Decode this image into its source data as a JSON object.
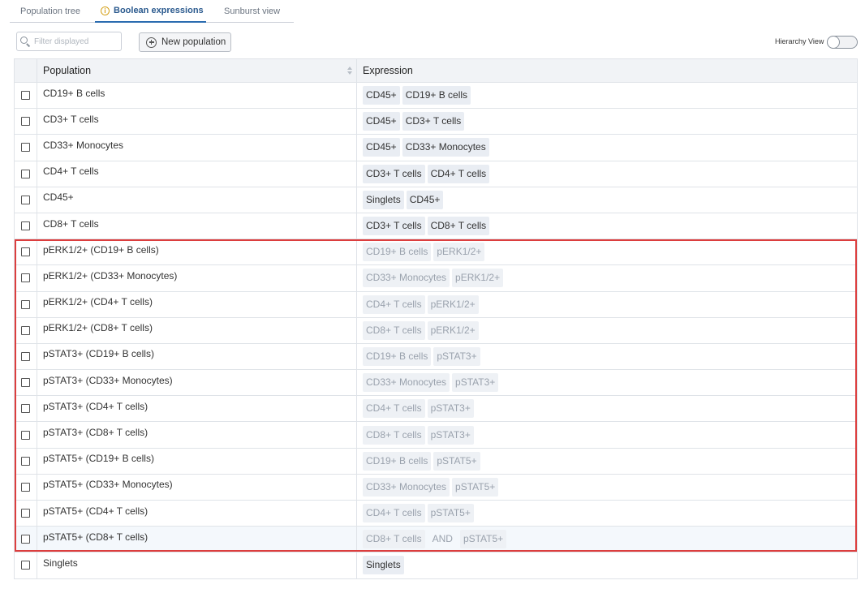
{
  "tabs": [
    {
      "label": "Population tree"
    },
    {
      "label": "Boolean expressions"
    },
    {
      "label": "Sunburst view"
    }
  ],
  "toolbar": {
    "filter_placeholder": "Filter displayed",
    "new_population_label": "New population",
    "hierarchy_view_label": "Hierarchy View",
    "hierarchy_view_on": false
  },
  "table": {
    "headers": {
      "population": "Population",
      "expression": "Expression"
    },
    "rows": [
      {
        "population": "CD19+ B cells",
        "expr": [
          "CD45+",
          "CD19+ B cells"
        ]
      },
      {
        "population": "CD3+ T cells",
        "expr": [
          "CD45+",
          "CD3+ T cells"
        ]
      },
      {
        "population": "CD33+ Monocytes",
        "expr": [
          "CD45+",
          "CD33+ Monocytes"
        ]
      },
      {
        "population": "CD4+ T cells",
        "expr": [
          "CD3+ T cells",
          "CD4+ T cells"
        ]
      },
      {
        "population": "CD45+",
        "expr": [
          "Singlets",
          "CD45+"
        ]
      },
      {
        "population": "CD8+ T cells",
        "expr": [
          "CD3+ T cells",
          "CD8+ T cells"
        ]
      },
      {
        "population": "pERK1/2+ (CD19+ B cells)",
        "expr": [
          "CD19+ B cells",
          "pERK1/2+"
        ]
      },
      {
        "population": "pERK1/2+ (CD33+ Monocytes)",
        "expr": [
          "CD33+ Monocytes",
          "pERK1/2+"
        ]
      },
      {
        "population": "pERK1/2+ (CD4+ T cells)",
        "expr": [
          "CD4+ T cells",
          "pERK1/2+"
        ]
      },
      {
        "population": "pERK1/2+ (CD8+ T cells)",
        "expr": [
          "CD8+ T cells",
          "pERK1/2+"
        ]
      },
      {
        "population": "pSTAT3+ (CD19+ B cells)",
        "expr": [
          "CD19+ B cells",
          "pSTAT3+"
        ]
      },
      {
        "population": "pSTAT3+ (CD33+ Monocytes)",
        "expr": [
          "CD33+ Monocytes",
          "pSTAT3+"
        ]
      },
      {
        "population": "pSTAT3+ (CD4+ T cells)",
        "expr": [
          "CD4+ T cells",
          "pSTAT3+"
        ]
      },
      {
        "population": "pSTAT3+ (CD8+ T cells)",
        "expr": [
          "CD8+ T cells",
          "pSTAT3+"
        ]
      },
      {
        "population": "pSTAT5+ (CD19+ B cells)",
        "expr": [
          "CD19+ B cells",
          "pSTAT5+"
        ]
      },
      {
        "population": "pSTAT5+ (CD33+ Monocytes)",
        "expr": [
          "CD33+ Monocytes",
          "pSTAT5+"
        ]
      },
      {
        "population": "pSTAT5+ (CD4+ T cells)",
        "expr": [
          "CD4+ T cells",
          "pSTAT5+"
        ]
      },
      {
        "population": "pSTAT5+ (CD8+ T cells)",
        "expr": [
          "CD8+ T cells",
          "AND",
          "pSTAT5+"
        ]
      },
      {
        "population": "Singlets",
        "expr": [
          "Singlets"
        ]
      }
    ]
  },
  "colors": {
    "selection_border": "#dc3e3e",
    "active_tab": "#2b5a8e",
    "chip_bg": "#e9edf3",
    "dim_text": "#9aa2ad"
  }
}
